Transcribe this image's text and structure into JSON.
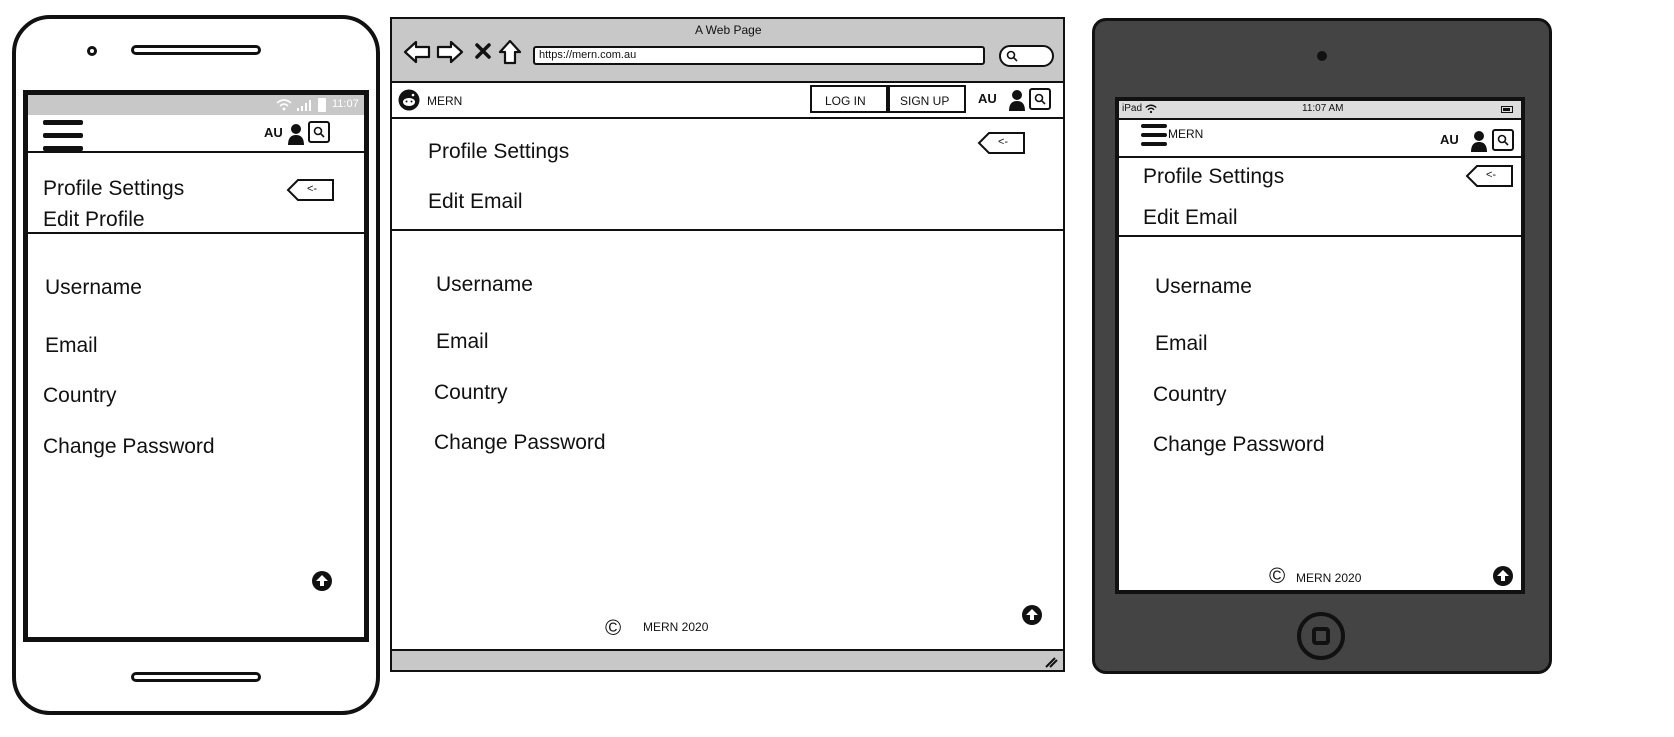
{
  "colors": {
    "ink": "#111111",
    "screen": "#ffffff",
    "bezel": "#444444",
    "chrome": "#c8c8c8"
  },
  "phone": {
    "status_time": "11:07",
    "locale": "AU",
    "title": "Profile Settings",
    "subtitle": "Edit Profile",
    "back_label": "<-",
    "items": [
      "Username",
      "Email",
      "Country",
      "Change Password"
    ]
  },
  "browser": {
    "window_title": "A Web Page",
    "url": "https://mern.com.au",
    "brand": "MERN",
    "login_label": "LOG IN",
    "signup_label": "SIGN UP",
    "locale": "AU",
    "title": "Profile Settings",
    "subtitle": "Edit Email",
    "back_label": "<-",
    "items": [
      "Username",
      "Email",
      "Country",
      "Change Password"
    ],
    "footer": "MERN 2020",
    "copyright_symbol": "©"
  },
  "tablet": {
    "device_label": "iPad",
    "status_time": "11:07 AM",
    "brand": "MERN",
    "locale": "AU",
    "title": "Profile Settings",
    "subtitle": "Edit Email",
    "back_label": "<-",
    "items": [
      "Username",
      "Email",
      "Country",
      "Change Password"
    ],
    "footer": "MERN 2020",
    "copyright_symbol": "©"
  }
}
